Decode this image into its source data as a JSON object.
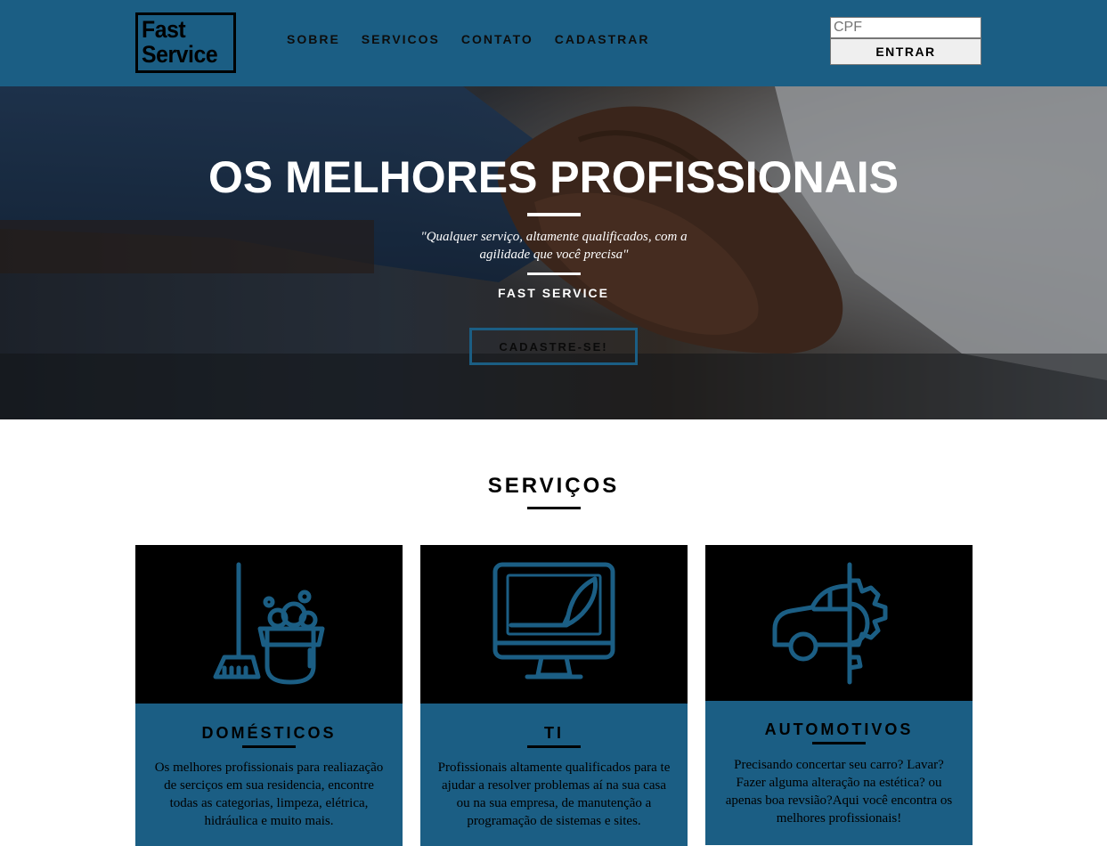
{
  "header": {
    "logo_line1": "Fast",
    "logo_line2": "Service",
    "nav": [
      "SOBRE",
      "SERVICOS",
      "CONTATO",
      "CADASTRAR"
    ],
    "login": {
      "placeholder": "CPF",
      "button_label": "ENTRAR"
    }
  },
  "hero": {
    "title": "OS MELHORES PROFISSIONAIS",
    "quote": "\"Qualquer serviço, altamente qualificados, com a agilidade que você precisa\"",
    "brand": "FAST SERVICE",
    "cta_label": "CADASTRE-SE!"
  },
  "services": {
    "title": "SERVIÇOS",
    "cards": [
      {
        "title": "DOMÉSTICOS",
        "icon": "mop-bucket-icon",
        "text": "Os melhores profissionais para realiazação de serciços em sua residencia, encontre todas as categorias, limpeza, elétrica, hidráulica e muito mais."
      },
      {
        "title": "TI",
        "icon": "monitor-feather-icon",
        "text": "Profissionais altamente qualificados para te ajudar a resolver problemas aí na sua casa ou na sua empresa, de manutenção a programação de sistemas e sites."
      },
      {
        "title": "AUTOMOTIVOS",
        "icon": "car-gear-icon",
        "text": "Precisando concertar seu carro? Lavar? Fazer alguma alteração na estética? ou apenas boa revsião?Aqui você encontra os melhores profissionais!"
      }
    ]
  },
  "colors": {
    "primary": "#1b5e84",
    "card_image_bg": "#000000",
    "text": "#000000"
  }
}
